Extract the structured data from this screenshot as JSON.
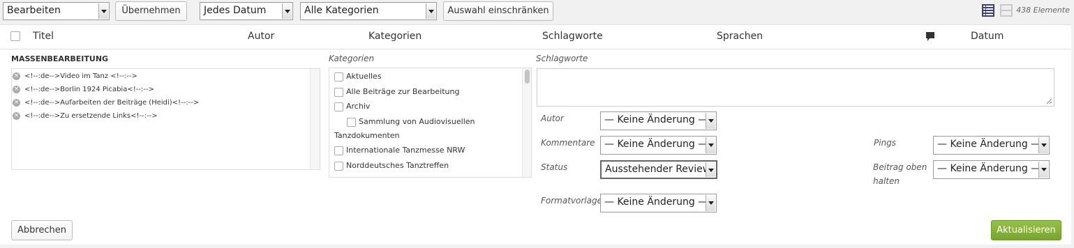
{
  "toolbar": {
    "bulk_action": "Bearbeiten",
    "apply_label": "Übernehmen",
    "date_filter": "Jedes Datum",
    "category_filter": "Alle Kategorien",
    "filter_label": "Auswahl einschränken",
    "item_count": "438 Elemente"
  },
  "columns": {
    "title": "Titel",
    "author": "Autor",
    "categories": "Kategorien",
    "tags": "Schlagworte",
    "languages": "Sprachen",
    "date": "Datum"
  },
  "bulk_edit": {
    "heading": "MASSENBEARBEITUNG",
    "posts": [
      "<!--:de-->Video im Tanz <!--:-->",
      "<!--:de-->Borlin 1924 Picabia<!--:-->",
      "<!--:de-->Aufarbeiten der Beiträge (Heidi)<!--:-->",
      "<!--:de-->Zu ersetzende Links<!--:-->"
    ],
    "categories_label": "Kategorien",
    "categories": [
      "Aktuelles",
      "Alle Beiträge zur Bearbeitung",
      "Archiv",
      "Sammlung von Audiovisuellen",
      "Tanzdokumenten",
      "Internationale Tanzmesse NRW",
      "Norddeutsches Tanztreffen"
    ],
    "tags_label": "Schlagworte",
    "fields": {
      "author_label": "Autor",
      "author_value": "— Keine Änderung —",
      "comments_label": "Kommentare",
      "comments_value": "— Keine Änderung —",
      "status_label": "Status",
      "status_value": "Ausstehender Review",
      "format_label": "Formatvorlage",
      "format_value": "— Keine Änderung —",
      "pings_label": "Pings",
      "pings_value": "— Keine Änderung —",
      "sticky_label_1": "Beitrag oben",
      "sticky_label_2": "halten",
      "sticky_value": "— Keine Änderung —"
    },
    "cancel_label": "Abbrechen",
    "update_label": "Aktualisieren"
  }
}
